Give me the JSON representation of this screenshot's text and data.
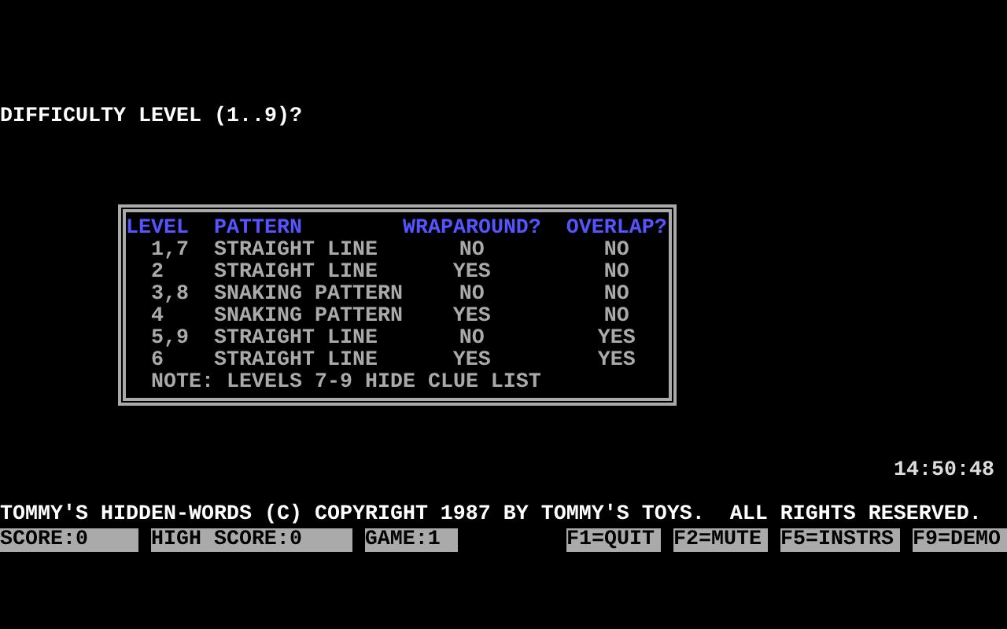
{
  "prompt": "DIFFICULTY LEVEL (1..9)?",
  "table": {
    "columns": [
      "LEVEL",
      "PATTERN",
      "WRAPAROUND?",
      "OVERLAP?"
    ],
    "rows": [
      [
        "1,7",
        "STRAIGHT LINE",
        "NO",
        "NO"
      ],
      [
        "2",
        "STRAIGHT LINE",
        "YES",
        "NO"
      ],
      [
        "3,8",
        "SNAKING PATTERN",
        "NO",
        "NO"
      ],
      [
        "4",
        "SNAKING PATTERN",
        "YES",
        "NO"
      ],
      [
        "5,9",
        "STRAIGHT LINE",
        "NO",
        "YES"
      ],
      [
        "6",
        "STRAIGHT LINE",
        "YES",
        "YES"
      ]
    ],
    "note": "NOTE: LEVELS 7-9 HIDE CLUE LIST"
  },
  "clock": "14:50:48",
  "copyright": "TOMMY'S HIDDEN-WORDS (C) COPYRIGHT 1987 BY TOMMY'S TOYS.  ALL RIGHTS RESERVED.",
  "status_bar": {
    "fields": [
      {
        "label": "SCORE:",
        "value": "0"
      },
      {
        "label": "HIGH SCORE:",
        "value": "0"
      },
      {
        "label": "GAME:",
        "value": "1"
      }
    ],
    "keys": [
      "F1=QUIT",
      "F2=MUTE",
      "F5=INSTRS",
      "F9=DEMO"
    ]
  }
}
